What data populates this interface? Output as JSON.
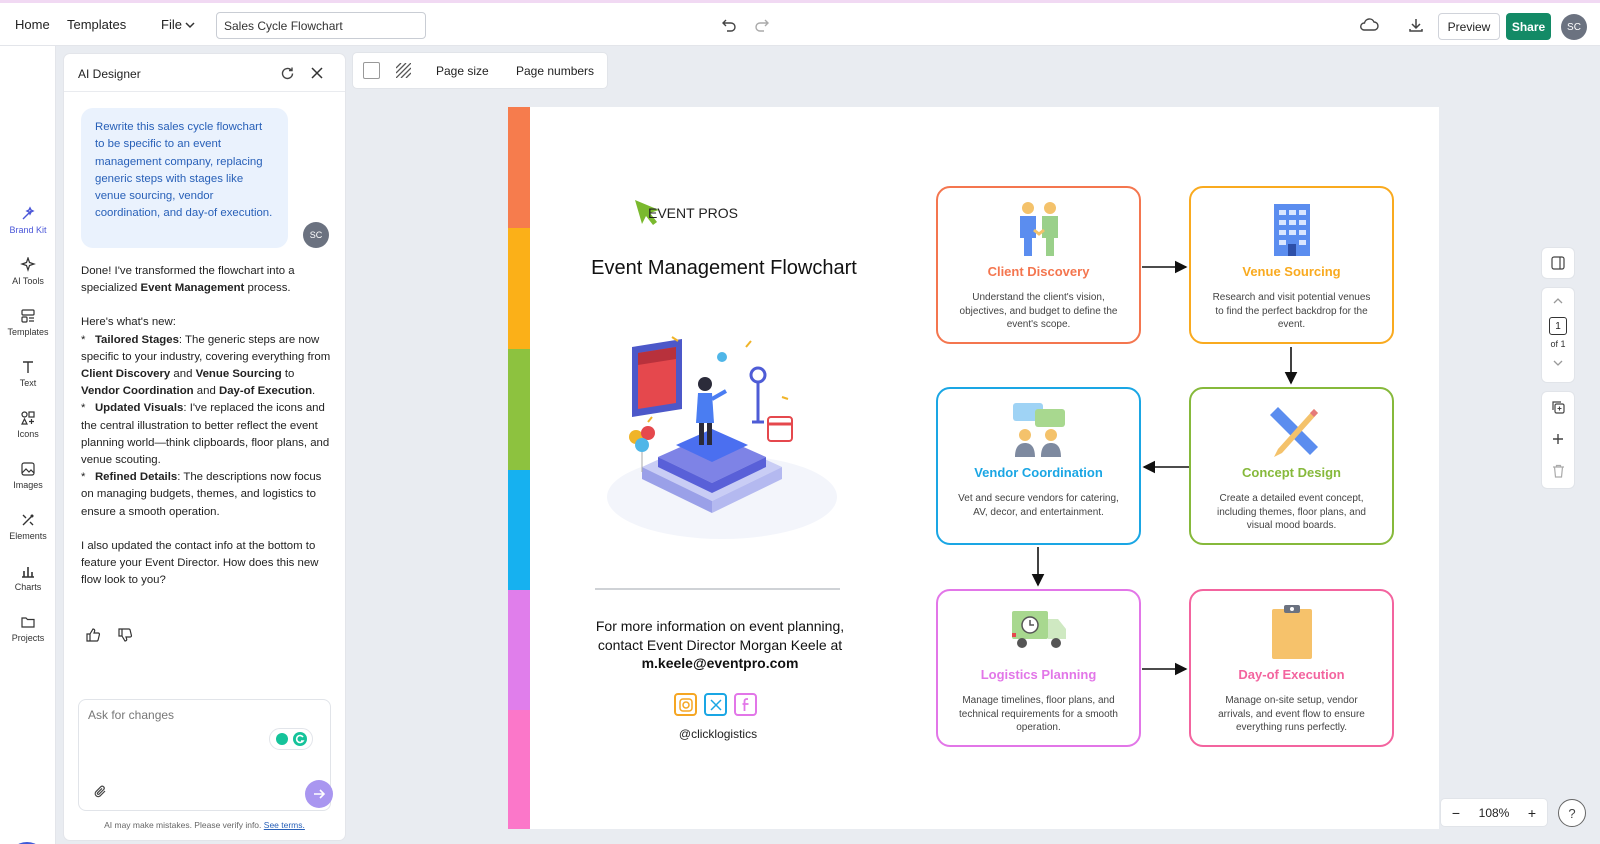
{
  "topbar": {
    "home": "Home",
    "templates": "Templates",
    "file": "File",
    "doc_name": "Sales Cycle Flowchart",
    "preview": "Preview",
    "share": "Share",
    "avatar": "SC"
  },
  "rail": [
    {
      "label": "Brand Kit",
      "icon": "magic-wand-icon",
      "active": true
    },
    {
      "label": "AI Tools",
      "icon": "sparkles-icon"
    },
    {
      "label": "Templates",
      "icon": "templates-icon"
    },
    {
      "label": "Text",
      "icon": "text-icon"
    },
    {
      "label": "Icons",
      "icon": "shapes-icon"
    },
    {
      "label": "Images",
      "icon": "image-icon"
    },
    {
      "label": "Elements",
      "icon": "elements-icon"
    },
    {
      "label": "Charts",
      "icon": "chart-icon"
    },
    {
      "label": "Projects",
      "icon": "folder-icon"
    }
  ],
  "panel": {
    "title": "AI Designer",
    "user_msg": "Rewrite this sales cycle flowchart to be specific to an event management company, replacing generic steps with stages like venue sourcing, vendor coordination, and day-of execution.",
    "user_avatar": "SC",
    "reply": {
      "intro_a": "Done! I've transformed the flowchart into a specialized ",
      "intro_b": "Event Management",
      "intro_c": " process.",
      "whats_new": "Here's what's new:",
      "bullet": "*",
      "b1_title": "Tailored Stages",
      "b1_a": ": The generic steps are now specific to your industry, covering everything from ",
      "b1_b": "Client Discovery",
      "b1_c": " and ",
      "b1_d": "Venue Sourcing",
      "b1_e": " to ",
      "b1_f": "Vendor Coordination",
      "b1_g": " and ",
      "b1_h": "Day-of Execution",
      "b1_i": ".",
      "b2_title": "Updated Visuals",
      "b2_text": ": I've replaced the icons and the central illustration to better reflect the event planning world—think clipboards, floor plans, and venue scouting.",
      "b3_title": "Refined Details",
      "b3_text": ": The descriptions now focus on managing budgets, themes, and logistics to ensure a smooth operation.",
      "outro": "I also updated the contact info at the bottom to feature your Event Director. How does this new flow look to you?"
    },
    "input_placeholder": "Ask for changes",
    "disclaimer": "AI may make mistakes. Please verify info.",
    "disclaimer_link": "See terms."
  },
  "page_toolbar": {
    "page_size": "Page size",
    "page_numbers": "Page numbers"
  },
  "canvas": {
    "brand": "EVENT PROS",
    "title": "Event Management Flowchart",
    "contact_line1": "For more information on event planning,",
    "contact_line2": "contact Event Director Morgan Keele at",
    "contact_email": "m.keele@eventpro.com",
    "handle": "@clicklogistics",
    "stripe_colors": [
      "#f67c4d",
      "#fbb018",
      "#8dc23f",
      "#16b1f0",
      "#e07eeb",
      "#fb77c9"
    ],
    "cards": [
      {
        "title": "Client Discovery",
        "desc": "Understand the client's vision, objectives, and budget to define the event's scope.",
        "color": "#f4764f",
        "icon": "handshake-people-icon"
      },
      {
        "title": "Venue Sourcing",
        "desc": "Research and visit potential venues to find the perfect backdrop for the event.",
        "color": "#f9aa1f",
        "icon": "building-icon"
      },
      {
        "title": "Vendor Coordination",
        "desc": "Vet and secure vendors for catering, AV, decor, and entertainment.",
        "color": "#1aa6e4",
        "icon": "chat-people-icon"
      },
      {
        "title": "Concept Design",
        "desc": "Create a detailed event concept, including themes, floor plans, and visual mood boards.",
        "color": "#86b93b",
        "icon": "pencil-ruler-icon"
      },
      {
        "title": "Logistics Planning",
        "desc": "Manage timelines, floor plans, and technical requirements for a smooth operation.",
        "color": "#e276e8",
        "icon": "delivery-truck-icon"
      },
      {
        "title": "Day-of Execution",
        "desc": "Manage on-site setup, vendor arrivals, and event flow to ensure everything runs perfectly.",
        "color": "#f3649f",
        "icon": "clipboard-icon"
      }
    ]
  },
  "pager": {
    "current": "1",
    "total": "of 1"
  },
  "zoom": {
    "level": "108%",
    "minus": "−",
    "plus": "+"
  }
}
